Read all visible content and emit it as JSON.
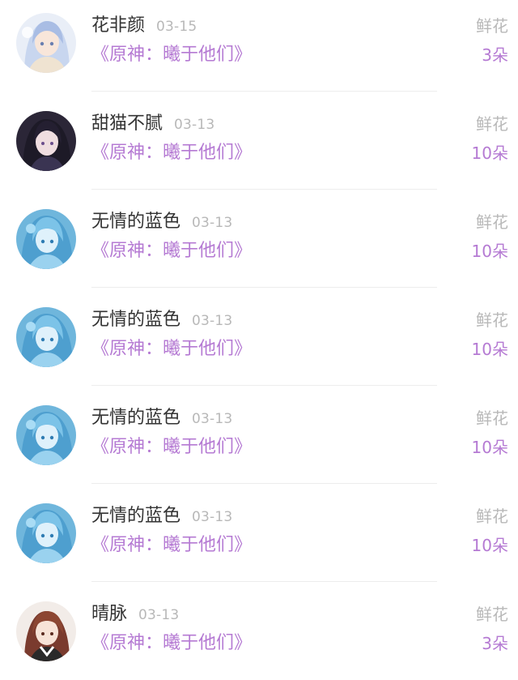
{
  "rows": [
    {
      "user": "花非颜",
      "date": "03-15",
      "book": "《原神：曦于他们》",
      "gift": "鲜花",
      "count": "3朵",
      "avatar": "avatar-silver-hair-girl"
    },
    {
      "user": "甜猫不腻",
      "date": "03-13",
      "book": "《原神：曦于他们》",
      "gift": "鲜花",
      "count": "10朵",
      "avatar": "avatar-dark-hair-girl"
    },
    {
      "user": "无情的蓝色",
      "date": "03-13",
      "book": "《原神：曦于他们》",
      "gift": "鲜花",
      "count": "10朵",
      "avatar": "avatar-blue-hair-girl"
    },
    {
      "user": "无情的蓝色",
      "date": "03-13",
      "book": "《原神：曦于他们》",
      "gift": "鲜花",
      "count": "10朵",
      "avatar": "avatar-blue-hair-girl"
    },
    {
      "user": "无情的蓝色",
      "date": "03-13",
      "book": "《原神：曦于他们》",
      "gift": "鲜花",
      "count": "10朵",
      "avatar": "avatar-blue-hair-girl"
    },
    {
      "user": "无情的蓝色",
      "date": "03-13",
      "book": "《原神：曦于他们》",
      "gift": "鲜花",
      "count": "10朵",
      "avatar": "avatar-blue-hair-girl"
    },
    {
      "user": "晴脉",
      "date": "03-13",
      "book": "《原神：曦于他们》",
      "gift": "鲜花",
      "count": "3朵",
      "avatar": "avatar-brown-hair-boy"
    }
  ],
  "colors": {
    "accent": "#b57ad3",
    "muted": "#b8b8b8",
    "text": "#333333"
  }
}
